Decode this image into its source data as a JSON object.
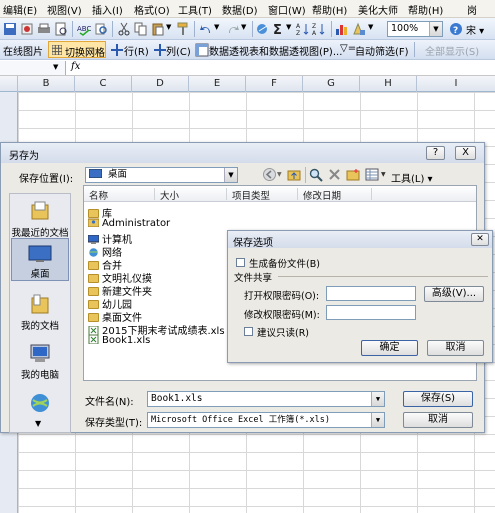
{
  "menubar": {
    "items": [
      "编辑(E)",
      "视图(V)",
      "插入(I)",
      "格式(O)",
      "工具(T)",
      "数据(D)",
      "窗口(W)",
      "帮助(H)",
      "美化大师",
      "帮助(H)",
      "岗"
    ]
  },
  "toolbar1": {
    "zoom": "100%"
  },
  "toolbar2": {
    "online_pictures": "在线图片",
    "toggle_grid": "切换网格",
    "row": "行(R)",
    "column": "列(C)",
    "pivot": "数据透视表和数据透视图(P)...",
    "autofilter": "自动筛选(F)",
    "show_all": "全部显示(S)"
  },
  "formula": {
    "fx": "fx"
  },
  "sheet": {
    "columns": [
      "B",
      "C",
      "D",
      "E",
      "F",
      "G",
      "H",
      "I"
    ]
  },
  "save_as": {
    "title": "另存为",
    "help_glyph": "?",
    "close_glyph": "X",
    "location_label": "保存位置(I):",
    "location_value": "桌面",
    "tools_label": "工具(L)",
    "places": [
      "我最近的文档",
      "桌面",
      "我的文档",
      "我的电脑",
      ""
    ],
    "columns": [
      "名称",
      "大小",
      "项目类型",
      "修改日期"
    ],
    "files": [
      "库",
      "Administrator",
      "计算机",
      "网络",
      "合并",
      "文明礼仪摸",
      "新建文件夹",
      "幼儿园",
      "桌面文件",
      "2015下期末考试成绩表.xls",
      "Book1.xls"
    ],
    "filename_label": "文件名(N):",
    "filename_value": "Book1.xls",
    "filetype_label": "保存类型(T):",
    "filetype_value": "Microsoft Office Excel 工作簿(*.xls)",
    "save_button": "保存(S)",
    "cancel_button": "取消"
  },
  "save_options": {
    "title": "保存选项",
    "backup_label": "生成备份文件(B)",
    "file_sharing": "文件共享",
    "open_password_label": "打开权限密码(O):",
    "modify_password_label": "修改权限密码(M):",
    "advanced_button": "高级(V)...",
    "readonly_label": "建议只读(R)",
    "ok_button": "确定",
    "cancel_button": "取消"
  }
}
